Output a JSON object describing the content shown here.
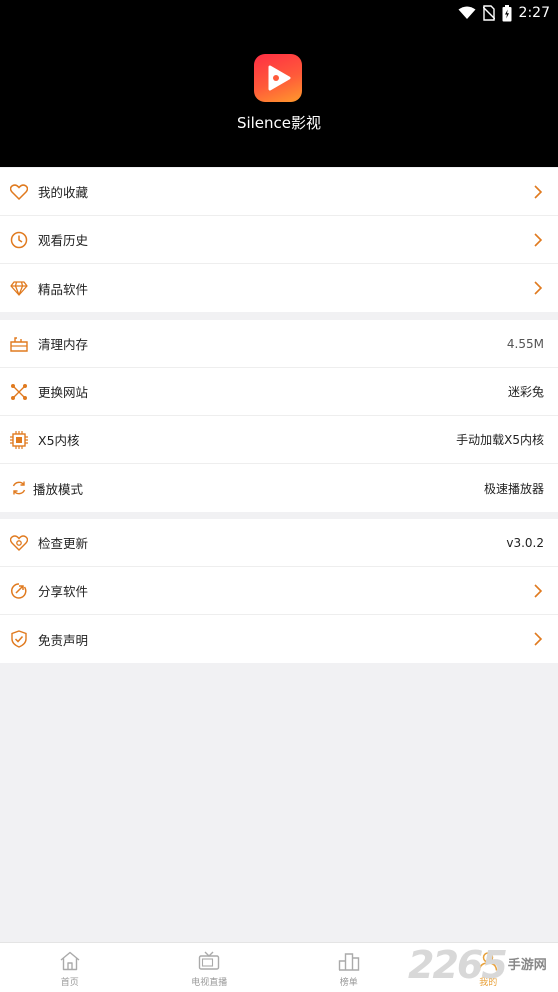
{
  "status_bar": {
    "time": "2:27"
  },
  "profile": {
    "app_name": "Silence影视"
  },
  "accent_color": "#e07a1f",
  "groups": [
    {
      "items": [
        {
          "label": "我的收藏",
          "icon": "heart-icon",
          "value": "",
          "chevron": true
        },
        {
          "label": "观看历史",
          "icon": "clock-icon",
          "value": "",
          "chevron": true
        },
        {
          "label": "精品软件",
          "icon": "diamond-icon",
          "value": "",
          "chevron": true
        }
      ]
    },
    {
      "items": [
        {
          "label": "清理内存",
          "icon": "clean-icon",
          "value": "4.55M",
          "chevron": false
        },
        {
          "label": "更换网站",
          "icon": "network-icon",
          "value": "迷彩兔",
          "chevron": false
        },
        {
          "label": "X5内核",
          "icon": "chip-icon",
          "value": "手动加载X5内核",
          "chevron": false
        },
        {
          "label": "播放模式",
          "icon": "refresh-icon",
          "value": "极速播放器",
          "chevron": false
        }
      ]
    },
    {
      "items": [
        {
          "label": "检查更新",
          "icon": "update-icon",
          "value": "v3.0.2",
          "chevron": false
        },
        {
          "label": "分享软件",
          "icon": "share-icon",
          "value": "",
          "chevron": true
        },
        {
          "label": "免责声明",
          "icon": "shield-check-icon",
          "value": "",
          "chevron": true
        }
      ]
    }
  ],
  "tabbar": [
    {
      "label": "首页",
      "icon": "home-icon",
      "active": false
    },
    {
      "label": "电视直播",
      "icon": "tv-icon",
      "active": false
    },
    {
      "label": "榜单",
      "icon": "ranking-icon",
      "active": false
    },
    {
      "label": "我的",
      "icon": "user-icon",
      "active": true
    }
  ],
  "watermark": {
    "number": "2265",
    "text": "手游网"
  }
}
